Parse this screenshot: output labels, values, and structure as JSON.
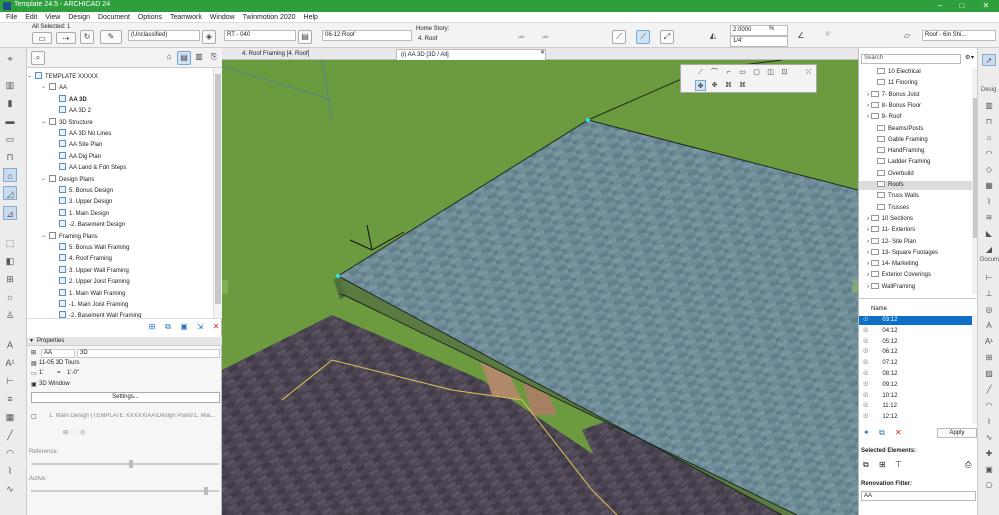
{
  "title_bar": {
    "title": "Template 24.5 - ARCHICAD 24",
    "minimize": "–",
    "maximize": "□",
    "close": "✕"
  },
  "menu": [
    "File",
    "Edit",
    "View",
    "Design",
    "Document",
    "Options",
    "Teamwork",
    "Window",
    "Twinmotion 2020",
    "Help"
  ],
  "toolbar": {
    "all_selected": "All Selected: 1",
    "classification": "(Unclassified)",
    "layer": "RT - 040",
    "view_name": "06-12 Roof",
    "home_story_label": "Home Story:",
    "home_story_value": "4. Roof",
    "scale_value": "2.0000",
    "scale_unit": "%",
    "offset_value": "1/4'",
    "angle_value": "6\"",
    "composite": "Roof - 6in Shi..."
  },
  "navigator": {
    "items": [
      {
        "label": "TEMPLATE XXXXX",
        "level": 0
      },
      {
        "label": "AA",
        "level": 1
      },
      {
        "label": "AA 3D",
        "level": 2,
        "bold": true
      },
      {
        "label": "AA 3D 2",
        "level": 2
      },
      {
        "label": "3D Structure",
        "level": 1
      },
      {
        "label": "AA 3D No Lines",
        "level": 2
      },
      {
        "label": "AA Site Plan",
        "level": 2
      },
      {
        "label": "AA Dig Plan",
        "level": 2
      },
      {
        "label": "AA Land & Fdn Steps",
        "level": 2
      },
      {
        "label": "Design Plans",
        "level": 1
      },
      {
        "label": "5. Bonus Design",
        "level": 2
      },
      {
        "label": "3. Upper Design",
        "level": 2
      },
      {
        "label": "1. Main Design",
        "level": 2
      },
      {
        "label": "-2. Basement Design",
        "level": 2
      },
      {
        "label": "Framing Plans",
        "level": 1
      },
      {
        "label": "5. Bonus Wall Framing",
        "level": 2
      },
      {
        "label": "4. Roof Framing",
        "level": 2
      },
      {
        "label": "3. Upper Wall Framing",
        "level": 2
      },
      {
        "label": "2. Upper Joist Framing",
        "level": 2
      },
      {
        "label": "1. Main Wall Framing",
        "level": 2
      },
      {
        "label": "-1. Main Joist Framing",
        "level": 2
      },
      {
        "label": "-2. Basement Wall Framing",
        "level": 2
      }
    ]
  },
  "properties": {
    "header": "Properties",
    "id_label": "AA",
    "id_value": "3D",
    "view_type": "11-05 3D Tours",
    "scale_a": "1'",
    "scale_eq": "=",
    "scale_b": "1'-0\"",
    "window_type": "3D Window",
    "settings_button": "Settings...",
    "source_path": "1. Main Design (TEMPLATE XXXXX\\AA\\Design Plans\\1. Mai...",
    "reference_label": "Reference:",
    "active_label": "Active:"
  },
  "tabs": [
    {
      "label": "4. Roof Framing [4. Roof]"
    },
    {
      "label": "(i) AA 3D [3D / All]"
    }
  ],
  "right_panel": {
    "search_placeholder": "Search",
    "folders": [
      {
        "label": "10 Electrical",
        "level": 1
      },
      {
        "label": "11 Flooring",
        "level": 1
      },
      {
        "label": "7- Bonus Joist",
        "level": 0
      },
      {
        "label": "8- Bonus Floor",
        "level": 0
      },
      {
        "label": "9- Roof",
        "level": 0
      },
      {
        "label": "Beams/Posts",
        "level": 1
      },
      {
        "label": "Gable Framing",
        "level": 1
      },
      {
        "label": "HandFraming",
        "level": 1
      },
      {
        "label": "Ladder Framing",
        "level": 1
      },
      {
        "label": "Overbuild",
        "level": 1
      },
      {
        "label": "Roofs",
        "level": 1,
        "selected": true
      },
      {
        "label": "Truss Walls",
        "level": 1
      },
      {
        "label": "Trusses",
        "level": 1
      },
      {
        "label": "10 Sections",
        "level": 0
      },
      {
        "label": "11- Exteriors",
        "level": 0
      },
      {
        "label": "12- Site Plan",
        "level": 0
      },
      {
        "label": "13- Square Footages",
        "level": 0
      },
      {
        "label": "14- Marketing",
        "level": 0
      },
      {
        "label": "Exterior Coverings",
        "level": 0
      },
      {
        "label": "WallFraming",
        "level": 0
      }
    ],
    "name_header": "Name",
    "times": [
      "03:12",
      "04:12",
      "05:12",
      "06:12",
      "07:12",
      "08:12",
      "09:12",
      "10:12",
      "11:12",
      "12:12"
    ],
    "selected_time_index": 0,
    "apply_button": "Apply",
    "selected_elements_label": "Selected Elements:",
    "renovation_filter_label": "Renovation Filter:",
    "renovation_filter_value": "AA"
  },
  "right_bar": {
    "design_label": "Desig",
    "document_label": "Docum"
  },
  "colors": {
    "title_green": "#2f9e3c",
    "ground_green": "#6b9a3f",
    "roof_blue": "#6b8a95",
    "selection_blue": "#0f6fc6"
  }
}
